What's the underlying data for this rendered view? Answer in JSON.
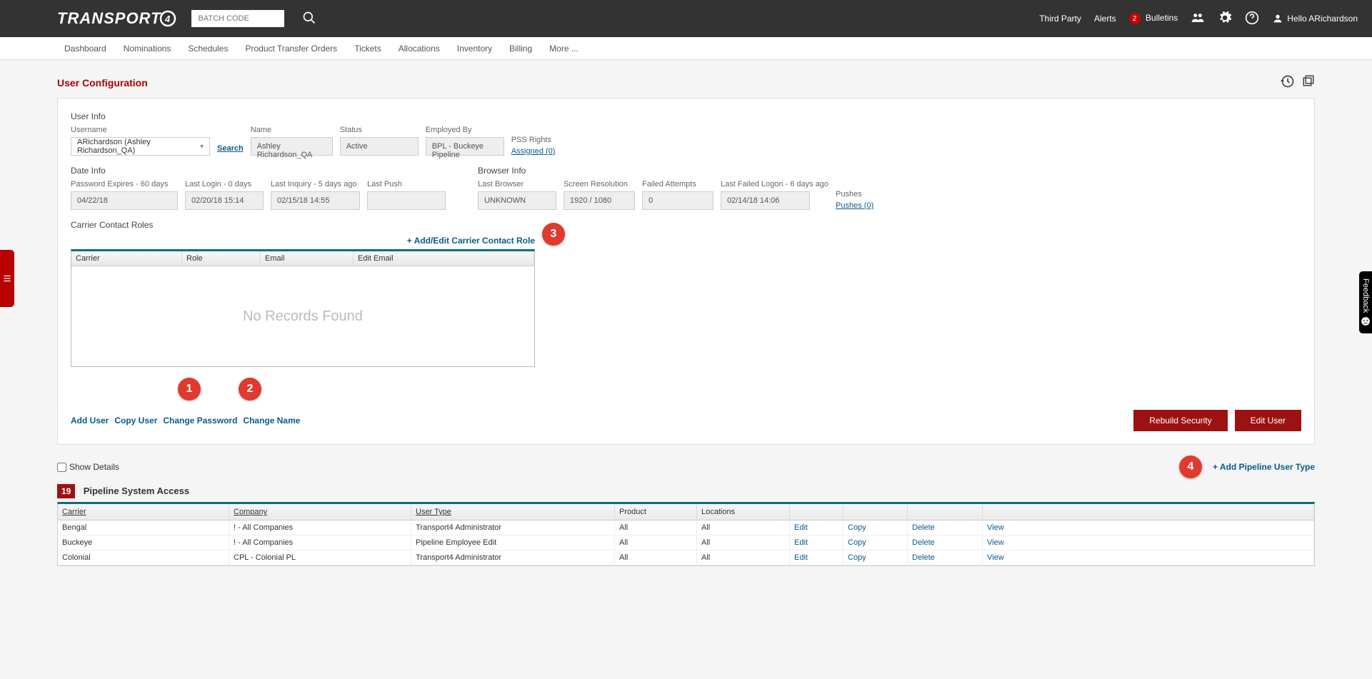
{
  "header": {
    "logo_text": "TRANSPORT",
    "batch_placeholder": "BATCH CODE",
    "third_party": "Third Party",
    "alerts": "Alerts",
    "bulletin_count": "2",
    "bulletins": "Bulletins",
    "greeting": "Hello ARichardson"
  },
  "nav": {
    "items": [
      "Dashboard",
      "Nominations",
      "Schedules",
      "Product Transfer Orders",
      "Tickets",
      "Allocations",
      "Inventory",
      "Billing",
      "More ..."
    ]
  },
  "page": {
    "title": "User Configuration"
  },
  "user_info": {
    "section": "User Info",
    "username_label": "Username",
    "username_value": "ARichardson (Ashley Richardson_QA)",
    "search_link": "Search",
    "name_label": "Name",
    "name_value": "Ashley Richardson_QA",
    "status_label": "Status",
    "status_value": "Active",
    "employed_label": "Employed By",
    "employed_value": "BPL - Buckeye Pipeline",
    "pss_label": "PSS Rights",
    "pss_link": "Assigned (0)"
  },
  "date_info": {
    "section": "Date Info",
    "pw_label": "Password Expires - 60 days",
    "pw_value": "04/22/18",
    "login_label": "Last Login - 0 days",
    "login_value": "02/20/18 15:14",
    "inquiry_label": "Last Inquiry - 5 days ago",
    "inquiry_value": "02/15/18 14:55",
    "push_label": "Last Push",
    "push_value": ""
  },
  "browser_info": {
    "section": "Browser Info",
    "browser_label": "Last Browser",
    "browser_value": "UNKNOWN",
    "res_label": "Screen Resolution",
    "res_value": "1920 / 1080",
    "failed_label": "Failed Attempts",
    "failed_value": "0",
    "lastfail_label": "Last Failed Logon - 6 days ago",
    "lastfail_value": "02/14/18 14:06",
    "pushes_label": "Pushes",
    "pushes_link": "Pushes (0)"
  },
  "roles": {
    "section": "Carrier Contact Roles",
    "add_link": "+ Add/Edit Carrier Contact Role",
    "cols": {
      "c1": "Carrier",
      "c2": "Role",
      "c3": "Email",
      "c4": "Edit Email"
    },
    "empty": "No Records Found"
  },
  "actions": {
    "add_user": "Add User",
    "copy_user": "Copy User",
    "change_password": "Change Password",
    "change_name": "Change Name",
    "rebuild": "Rebuild Security",
    "edit": "Edit User"
  },
  "psa": {
    "show_details": "Show Details",
    "add_link": "+ Add Pipeline User Type",
    "count": "19",
    "title": "Pipeline System Access",
    "cols": {
      "carrier": "Carrier",
      "company": "Company",
      "usertype": "User Type",
      "product": "Product",
      "locations": "Locations"
    },
    "rows": [
      {
        "carrier": "Bengal",
        "company": "! - All Companies",
        "usertype": "Transport4 Administrator",
        "product": "All",
        "locations": "All",
        "a1": "Edit",
        "a2": "Copy",
        "a3": "Delete",
        "a4": "View"
      },
      {
        "carrier": "Buckeye",
        "company": "! - All Companies",
        "usertype": "Pipeline Employee Edit",
        "product": "All",
        "locations": "All",
        "a1": "Edit",
        "a2": "Copy",
        "a3": "Delete",
        "a4": "View"
      },
      {
        "carrier": "Colonial",
        "company": "CPL - Colonial PL",
        "usertype": "Transport4 Administrator",
        "product": "All",
        "locations": "All",
        "a1": "Edit",
        "a2": "Copy",
        "a3": "Delete",
        "a4": "View"
      }
    ]
  },
  "feedback": "Feedback",
  "bubbles": {
    "b1": "1",
    "b2": "2",
    "b3": "3",
    "b4": "4"
  }
}
